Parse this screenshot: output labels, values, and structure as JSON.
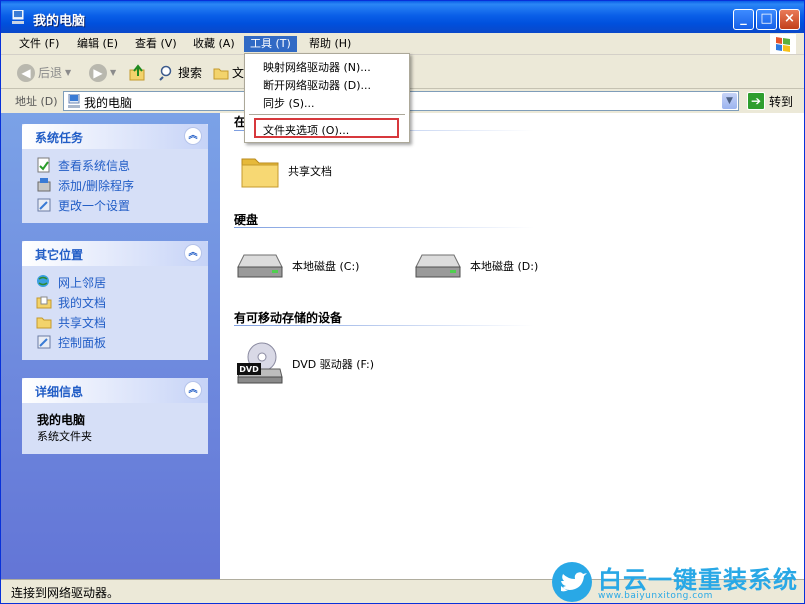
{
  "window": {
    "title": "我的电脑"
  },
  "menubar": {
    "items": [
      "文件 (F)",
      "编辑 (E)",
      "查看 (V)",
      "收藏 (A)",
      "工具 (T)",
      "帮助 (H)"
    ],
    "active_index": 4
  },
  "toolbar": {
    "back_label": "后退",
    "search_label": "搜索",
    "folders_label_partial": "文"
  },
  "address": {
    "label": "地址 (D)",
    "value": "我的电脑",
    "go_label": "转到"
  },
  "tools_menu": {
    "items": [
      "映射网络驱动器 (N)...",
      "断开网络驱动器 (D)...",
      "同步 (S)...",
      "文件夹选项 (O)..."
    ],
    "highlighted": "文件夹选项 (O)..."
  },
  "left_panel": {
    "system_tasks": {
      "title": "系统任务",
      "items": [
        "查看系统信息",
        "添加/删除程序",
        "更改一个设置"
      ]
    },
    "other_places": {
      "title": "其它位置",
      "items": [
        "网上邻居",
        "我的文档",
        "共享文档",
        "控制面板"
      ]
    },
    "details": {
      "title": "详细信息",
      "name": "我的电脑",
      "description": "系统文件夹"
    }
  },
  "content": {
    "group_stored_partial": "在",
    "shared_docs": "共享文档",
    "group_hard_disks": "硬盘",
    "drive_c": "本地磁盘 (C:)",
    "drive_d": "本地磁盘 (D:)",
    "group_removable": "有可移动存储的设备",
    "dvd_drive": "DVD 驱动器 (F:)",
    "dvd_badge": "DVD"
  },
  "statusbar": {
    "text": "连接到网络驱动器。"
  },
  "watermark": {
    "title": "白云一键重装系统",
    "url": "www.baiyunxitong.com"
  },
  "colors": {
    "titlebar": "#0a5fe8",
    "link": "#215dc6",
    "highlight_box": "#d7383c",
    "watermark": "#29a8e6"
  }
}
